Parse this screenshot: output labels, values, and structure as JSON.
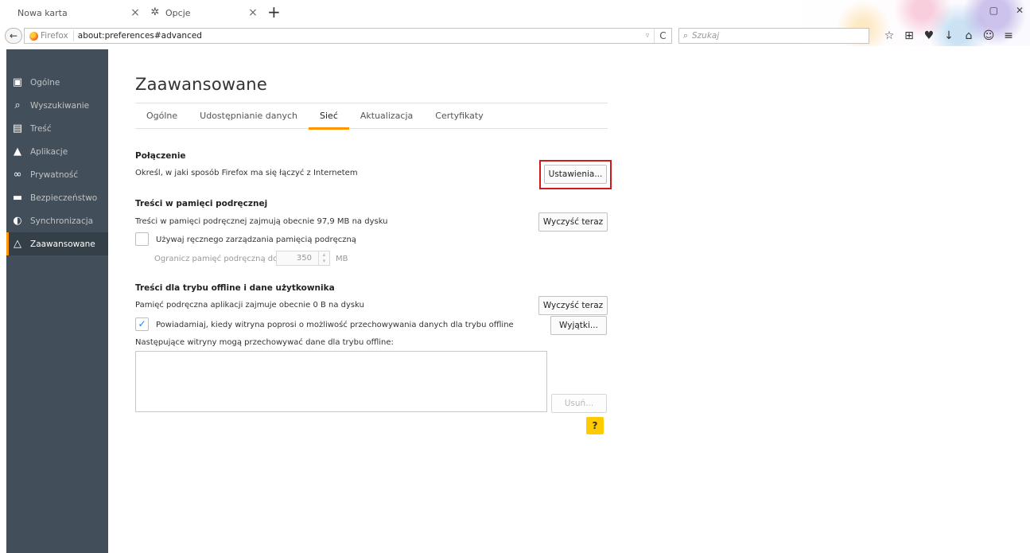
{
  "tabs": [
    {
      "title": "Nowa karta",
      "close": "×"
    },
    {
      "title": "Opcje",
      "close": "×",
      "icon": "gear-icon"
    }
  ],
  "new_tab": "+",
  "navbar": {
    "back": "←",
    "identity": "Firefox",
    "url": "about:preferences#advanced",
    "dropmarker": "▿",
    "reload": "C",
    "search_placeholder": "Szukaj"
  },
  "toolbar_icons": [
    "☆",
    "⊞",
    "♥",
    "↓",
    "⌂",
    "☺",
    "≡"
  ],
  "sidebar": {
    "items": [
      {
        "label": "Ogólne",
        "icon": "general-icon",
        "glyph": "▣"
      },
      {
        "label": "Wyszukiwanie",
        "icon": "search-icon",
        "glyph": "🔍"
      },
      {
        "label": "Treść",
        "icon": "content-icon",
        "glyph": "▤"
      },
      {
        "label": "Aplikacje",
        "icon": "applications-icon",
        "glyph": "▲"
      },
      {
        "label": "Prywatność",
        "icon": "privacy-icon",
        "glyph": "∞"
      },
      {
        "label": "Bezpieczeństwo",
        "icon": "security-icon",
        "glyph": "▬"
      },
      {
        "label": "Synchronizacja",
        "icon": "sync-icon",
        "glyph": "◐"
      },
      {
        "label": "Zaawansowane",
        "icon": "advanced-icon",
        "glyph": "△",
        "active": true
      }
    ]
  },
  "page": {
    "title": "Zaawansowane",
    "tabs": [
      "Ogólne",
      "Udostępnianie danych",
      "Sieć",
      "Aktualizacja",
      "Certyfikaty"
    ],
    "active_tab": "Sieć"
  },
  "connection": {
    "title": "Połączenie",
    "desc": "Określ, w jaki sposób Firefox ma się łączyć z Internetem",
    "button": "Ustawienia..."
  },
  "cache": {
    "title": "Treści w pamięci podręcznej",
    "desc": "Treści w pamięci podręcznej zajmują obecnie 97,9 MB na dysku",
    "button": "Wyczyść teraz",
    "checkbox_label": "Używaj ręcznego zarządzania pamięcią podręczną",
    "checkbox_checked": false,
    "limit_label": "Ogranicz pamięć podręczną do",
    "limit_value": "350",
    "limit_unit": "MB"
  },
  "offline": {
    "title": "Treści dla trybu offline i dane użytkownika",
    "desc": "Pamięć podręczna aplikacji zajmuje obecnie 0 B na dysku",
    "button": "Wyczyść teraz",
    "notify_label": "Powiadamiaj, kiedy witryna poprosi o możliwość przechowywania danych dla trybu offline",
    "notify_checked": true,
    "exceptions_button": "Wyjątki...",
    "sites_label": "Następujące witryny mogą przechowywać dane dla trybu offline:",
    "remove_button": "Usuń...",
    "help": "?"
  },
  "colors": {
    "sidebar_bg": "#424f5a",
    "accent": "#ff9500",
    "highlight": "#d0191b",
    "help_bg": "#ffcb00"
  }
}
